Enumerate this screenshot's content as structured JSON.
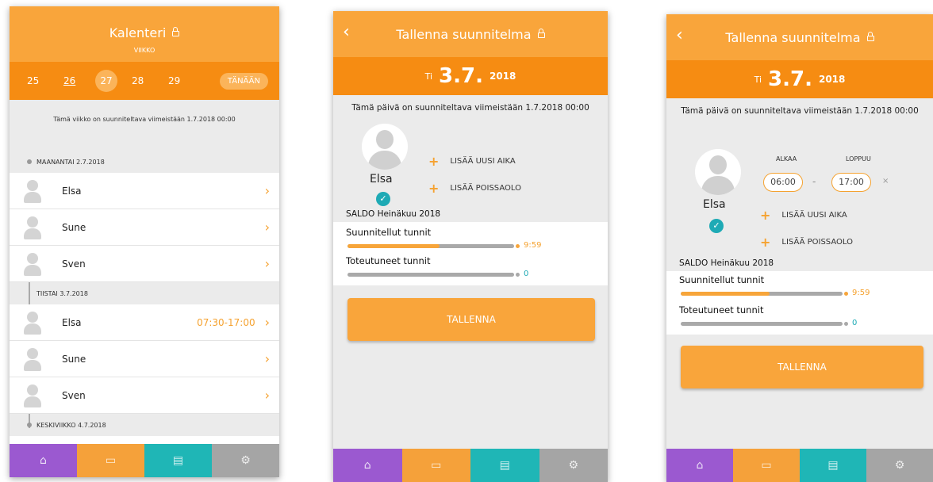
{
  "screen1": {
    "title": "Kalenteri",
    "subtitle": "VIIKKO",
    "days": [
      "25",
      "26",
      "27",
      "28",
      "29"
    ],
    "today_label": "TÄNÄÄN",
    "notice": "Tämä viikko on suunniteltava viimeistään 1.7.2018 00:00",
    "groups": [
      {
        "label": "MAANANTAI 2.7.2018",
        "rows": [
          {
            "name": "Elsa",
            "time": ""
          },
          {
            "name": "Sune",
            "time": ""
          },
          {
            "name": "Sven",
            "time": ""
          }
        ]
      },
      {
        "label": "TIISTAI 3.7.2018",
        "rows": [
          {
            "name": "Elsa",
            "time": "07:30-17:00"
          },
          {
            "name": "Sune",
            "time": ""
          },
          {
            "name": "Sven",
            "time": ""
          }
        ]
      },
      {
        "label": "KESKIVIIKKO 4.7.2018",
        "rows": []
      }
    ]
  },
  "plan": {
    "title": "Tallenna suunnitelma",
    "weekday": "Ti",
    "date": "3.7.",
    "year": "2018",
    "notice": "Tämä päivä on suunniteltava viimeistään 1.7.2018 00:00",
    "employee": "Elsa",
    "add_time": "LISÄÄ UUSI AIKA",
    "add_absence": "LISÄÄ POISSAOLO",
    "saldo": "SALDO Heinäkuu 2018",
    "planned_label": "Suunnitellut tunnit",
    "planned_value": "9:59",
    "planned_fraction": 0.55,
    "actual_label": "Toteutuneet tunnit",
    "actual_value": "0",
    "save": "TALLENNA",
    "start_label": "ALKAA",
    "end_label": "LOPPUU",
    "start_time": "06:00",
    "end_time": "17:00",
    "dash": "-",
    "remove": "×"
  },
  "colors": {
    "orange": "#f68c12",
    "light_orange": "#f9a53b",
    "teal": "#1eaab5",
    "purple": "#9b59d0"
  }
}
